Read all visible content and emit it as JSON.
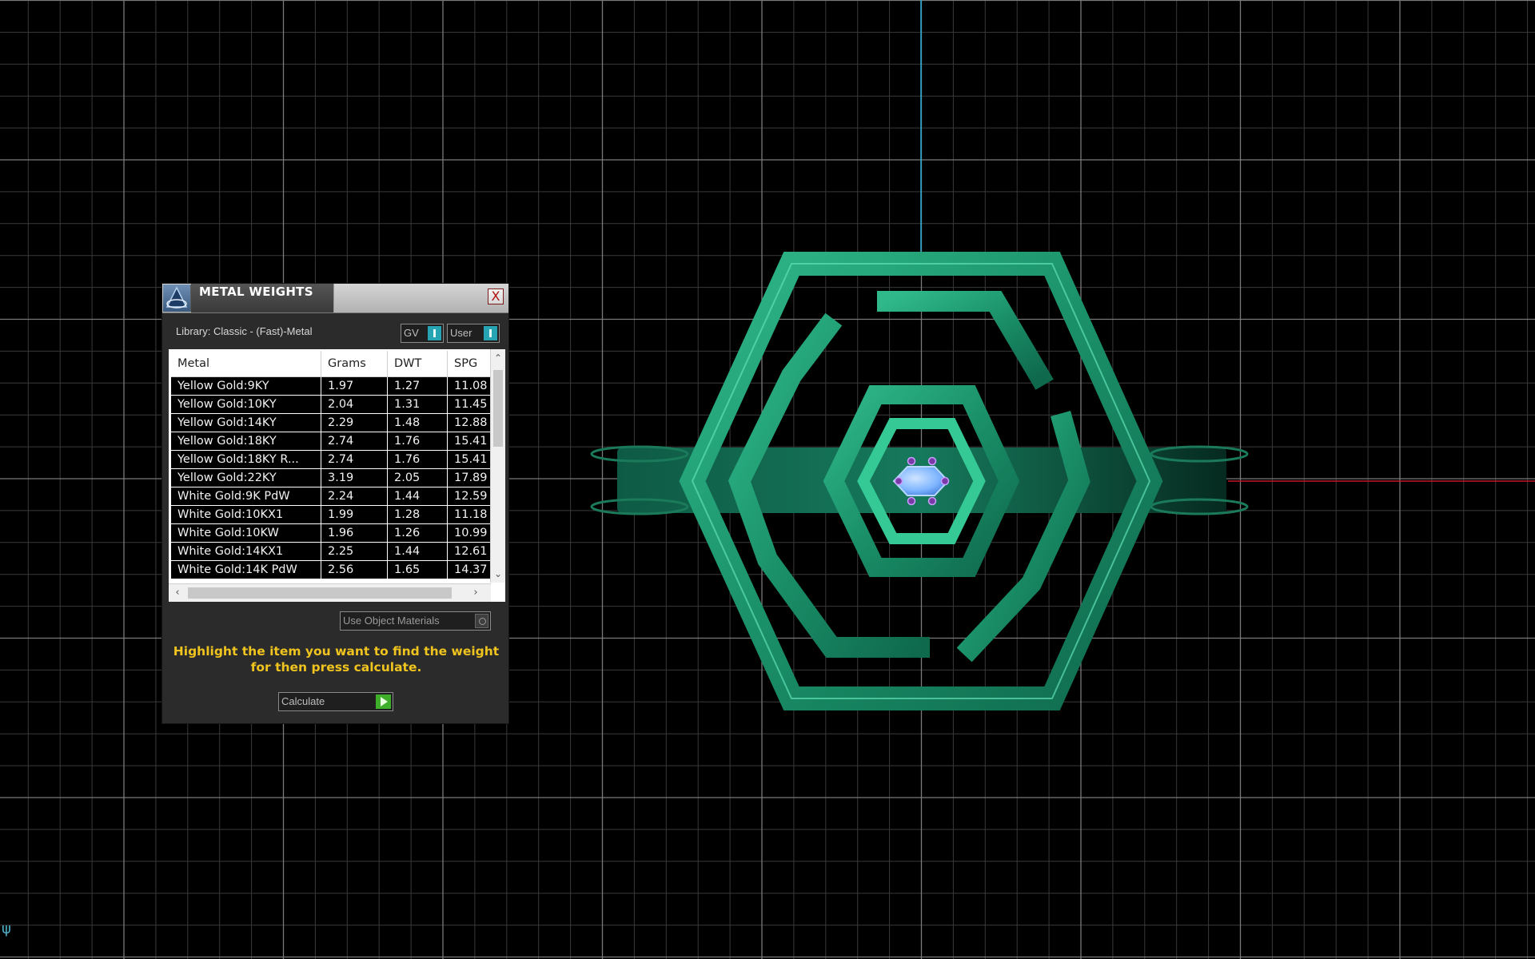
{
  "dialog": {
    "title": "METAL WEIGHTS",
    "close_label": "X",
    "library_label": "Library: Classic - (Fast)-Metal",
    "toggle_gv": "GV",
    "toggle_user": "User",
    "table": {
      "headers": [
        "Metal",
        "Grams",
        "DWT",
        "SPG"
      ],
      "rows": [
        {
          "metal": "Yellow Gold:9KY",
          "grams": "1.97",
          "dwt": "1.27",
          "spg": "11.08"
        },
        {
          "metal": "Yellow Gold:10KY",
          "grams": "2.04",
          "dwt": "1.31",
          "spg": "11.45"
        },
        {
          "metal": "Yellow Gold:14KY",
          "grams": "2.29",
          "dwt": "1.48",
          "spg": "12.88"
        },
        {
          "metal": "Yellow Gold:18KY",
          "grams": "2.74",
          "dwt": "1.76",
          "spg": "15.41"
        },
        {
          "metal": "Yellow Gold:18KY R...",
          "grams": "2.74",
          "dwt": "1.76",
          "spg": "15.41"
        },
        {
          "metal": "Yellow Gold:22KY",
          "grams": "3.19",
          "dwt": "2.05",
          "spg": "17.89"
        },
        {
          "metal": "White Gold:9K PdW",
          "grams": "2.24",
          "dwt": "1.44",
          "spg": "12.59"
        },
        {
          "metal": "White Gold:10KX1",
          "grams": "1.99",
          "dwt": "1.28",
          "spg": "11.18"
        },
        {
          "metal": "White Gold:10KW",
          "grams": "1.96",
          "dwt": "1.26",
          "spg": "10.99"
        },
        {
          "metal": "White Gold:14KX1",
          "grams": "2.25",
          "dwt": "1.44",
          "spg": "12.61"
        },
        {
          "metal": "White Gold:14K PdW",
          "grams": "2.56",
          "dwt": "1.65",
          "spg": "14.37"
        }
      ]
    },
    "use_materials_label": "Use Object Materials",
    "hint": "Highlight the item you want to find the weight for then press calculate.",
    "calculate_label": "Calculate"
  },
  "viewport": {
    "corner_icon": "axis-icon",
    "ring_color": "#1f8f6a",
    "gem_color": "#7fb6ff",
    "prong_color": "#7a3aa8"
  }
}
